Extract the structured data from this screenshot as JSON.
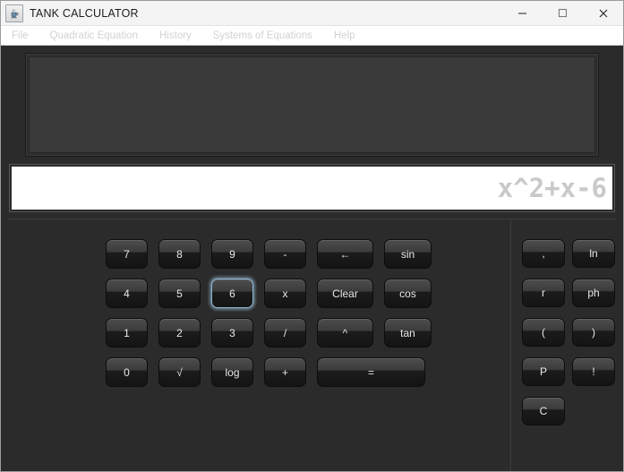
{
  "window": {
    "title": "TANK CALCULATOR",
    "app_icon": "java-cup-icon",
    "controls": {
      "minimize": "minimize-icon",
      "maximize": "maximize-icon",
      "close": "close-icon"
    }
  },
  "menubar": {
    "items": [
      {
        "label": "File"
      },
      {
        "label": "Quadratic Equation"
      },
      {
        "label": "History"
      },
      {
        "label": "Systems of Equations"
      },
      {
        "label": "Help"
      }
    ]
  },
  "display": {
    "output_text": "",
    "input_value": "x^2+x-6",
    "input_placeholder": "x^2+x-6"
  },
  "keypad": {
    "rows": [
      [
        {
          "label": "7",
          "kind": "num",
          "name": "key-7"
        },
        {
          "label": "8",
          "kind": "num",
          "name": "key-8"
        },
        {
          "label": "9",
          "kind": "num",
          "name": "key-9"
        },
        {
          "label": "-",
          "kind": "op",
          "name": "key-minus"
        },
        {
          "label": "←",
          "kind": "wide",
          "name": "key-backspace"
        },
        {
          "label": "sin",
          "kind": "fn",
          "name": "key-sin"
        }
      ],
      [
        {
          "label": "4",
          "kind": "num",
          "name": "key-4"
        },
        {
          "label": "5",
          "kind": "num",
          "name": "key-5"
        },
        {
          "label": "6",
          "kind": "num",
          "name": "key-6",
          "focused": true
        },
        {
          "label": "x",
          "kind": "op",
          "name": "key-x"
        },
        {
          "label": "Clear",
          "kind": "wide",
          "name": "key-clear"
        },
        {
          "label": "cos",
          "kind": "fn",
          "name": "key-cos"
        }
      ],
      [
        {
          "label": "1",
          "kind": "num",
          "name": "key-1"
        },
        {
          "label": "2",
          "kind": "num",
          "name": "key-2"
        },
        {
          "label": "3",
          "kind": "num",
          "name": "key-3"
        },
        {
          "label": "/",
          "kind": "op",
          "name": "key-divide"
        },
        {
          "label": "^",
          "kind": "wide",
          "name": "key-power"
        },
        {
          "label": "tan",
          "kind": "fn",
          "name": "key-tan"
        }
      ],
      [
        {
          "label": "0",
          "kind": "num",
          "name": "key-0"
        },
        {
          "label": "√",
          "kind": "num",
          "name": "key-sqrt"
        },
        {
          "label": "log",
          "kind": "num",
          "name": "key-log"
        },
        {
          "label": "+",
          "kind": "op",
          "name": "key-plus"
        },
        {
          "label": "=",
          "kind": "equals",
          "name": "key-equals"
        }
      ]
    ]
  },
  "side_panel": {
    "rows": [
      [
        {
          "label": ",",
          "name": "key-comma"
        },
        {
          "label": "ln",
          "name": "key-ln"
        }
      ],
      [
        {
          "label": "r",
          "name": "key-r"
        },
        {
          "label": "ph",
          "name": "key-ph"
        }
      ],
      [
        {
          "label": "(",
          "name": "key-open-paren"
        },
        {
          "label": ")",
          "name": "key-close-paren"
        }
      ],
      [
        {
          "label": "P",
          "name": "key-p"
        },
        {
          "label": "!",
          "name": "key-factorial"
        }
      ],
      [
        {
          "label": "C",
          "name": "key-c"
        }
      ]
    ]
  },
  "colors": {
    "window_chrome": "#2b2b2b",
    "button_top": "#4d4d4d",
    "button_bottom": "#141414",
    "focus_ring": "#8fb8d4",
    "input_text": "#c9c9c9",
    "menu_text": "#d2d2d2"
  }
}
